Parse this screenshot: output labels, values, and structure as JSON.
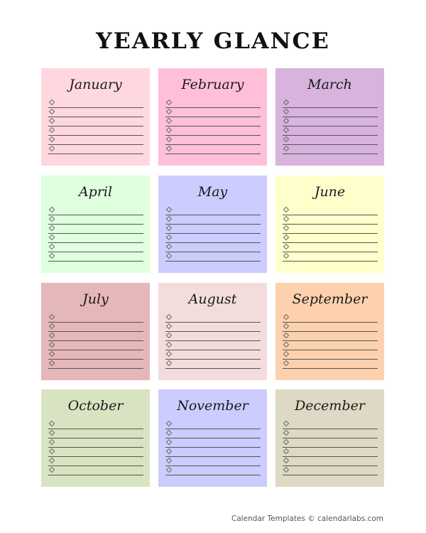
{
  "title": "YEARLY GLANCE",
  "months": [
    {
      "name": "January",
      "color": "#ffd7df",
      "lines": 6
    },
    {
      "name": "February",
      "color": "#ffbfd9",
      "lines": 6
    },
    {
      "name": "March",
      "color": "#d7b3de",
      "lines": 6
    },
    {
      "name": "April",
      "color": "#dfffdf",
      "lines": 6
    },
    {
      "name": "May",
      "color": "#ccccff",
      "lines": 6
    },
    {
      "name": "June",
      "color": "#ffffcc",
      "lines": 6
    },
    {
      "name": "July",
      "color": "#e6b7b9",
      "lines": 6
    },
    {
      "name": "August",
      "color": "#f3dcdc",
      "lines": 6
    },
    {
      "name": "September",
      "color": "#fdd1ae",
      "lines": 6
    },
    {
      "name": "October",
      "color": "#d8e3c1",
      "lines": 6
    },
    {
      "name": "November",
      "color": "#ccccff",
      "lines": 6
    },
    {
      "name": "December",
      "color": "#ddd9c4",
      "lines": 6
    }
  ],
  "footer": "Calendar Templates © calendarlabs.com"
}
